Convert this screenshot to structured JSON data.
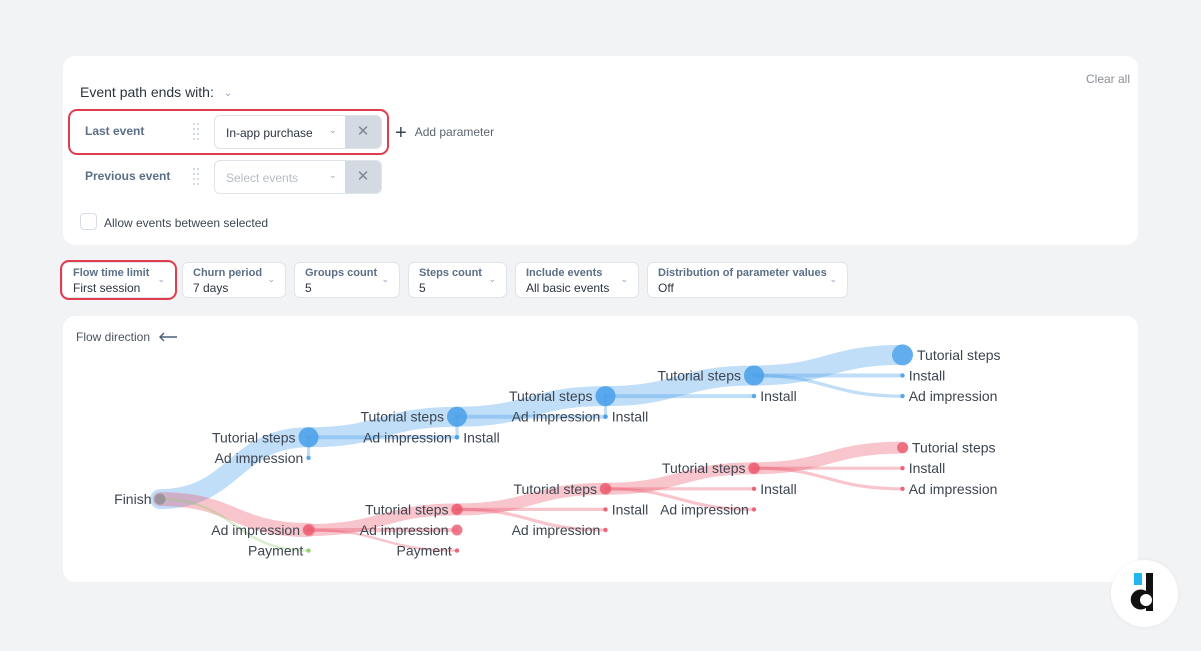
{
  "filters": {
    "title": "Event path ends with:",
    "clear_all": "Clear all",
    "rows": [
      {
        "label": "Last event",
        "value": "In-app purchase",
        "placeholder": ""
      },
      {
        "label": "Previous event",
        "value": "",
        "placeholder": "Select events"
      }
    ],
    "add_parameter": "Add parameter",
    "allow_between": {
      "label": "Allow events between selected",
      "checked": false
    },
    "highlight_color": "#e23d4f"
  },
  "settings": [
    {
      "label": "Flow time limit",
      "value": "First session",
      "highlighted": true
    },
    {
      "label": "Churn period",
      "value": "7 days"
    },
    {
      "label": "Groups count",
      "value": "5"
    },
    {
      "label": "Steps count",
      "value": "5"
    },
    {
      "label": "Include events",
      "value": "All basic events"
    },
    {
      "label": "Distribution of parameter values",
      "value": "Off"
    }
  ],
  "flow": {
    "direction_label": "Flow direction",
    "colors": {
      "blue": "#4aa0ea",
      "red": "#ea5a6e",
      "green": "#8fce6a",
      "finish": "#8d8d94"
    },
    "nodes": [
      {
        "id": "finish",
        "label": "Finish",
        "step": 0,
        "row": 3.5,
        "color": "finish",
        "size": "m"
      },
      {
        "id": "b1",
        "label": "Tutorial steps",
        "step": 1,
        "row": 0.5,
        "color": "blue",
        "size": "l"
      },
      {
        "id": "b1i",
        "label": "Install",
        "step": 2,
        "row": 0.5,
        "color": "blue",
        "size": "s",
        "labelSide": "right"
      },
      {
        "id": "b1a",
        "label": "Ad impression",
        "step": 1,
        "row": 1.5,
        "color": "blue",
        "size": "s"
      },
      {
        "id": "b2",
        "label": "Tutorial steps",
        "step": 2,
        "row": -0.5,
        "color": "blue",
        "size": "l"
      },
      {
        "id": "b2a",
        "label": "Ad impression",
        "step": 2,
        "row": 0.5,
        "color": "blue",
        "size": "s"
      },
      {
        "id": "b2i",
        "label": "Install",
        "step": 3,
        "row": -0.5,
        "color": "blue",
        "size": "s",
        "labelSide": "right"
      },
      {
        "id": "b3",
        "label": "Tutorial steps",
        "step": 3,
        "row": -1.5,
        "color": "blue",
        "size": "l"
      },
      {
        "id": "b3a",
        "label": "Ad impression",
        "step": 3,
        "row": -0.5,
        "color": "blue",
        "size": "s"
      },
      {
        "id": "b3i",
        "label": "Install",
        "step": 4,
        "row": -1.5,
        "color": "blue",
        "size": "s",
        "labelSide": "right"
      },
      {
        "id": "b4",
        "label": "Tutorial steps",
        "step": 4,
        "row": -2.5,
        "color": "blue",
        "size": "l"
      },
      {
        "id": "b5",
        "label": "Tutorial steps",
        "step": 5,
        "row": -3.5,
        "color": "blue",
        "size": "xl",
        "labelSide": "right"
      },
      {
        "id": "b5i",
        "label": "Install",
        "step": 5,
        "row": -2.5,
        "color": "blue",
        "size": "s",
        "labelSide": "right"
      },
      {
        "id": "b5a",
        "label": "Ad impression",
        "step": 5,
        "row": -1.5,
        "color": "blue",
        "size": "s",
        "labelSide": "right"
      },
      {
        "id": "r1",
        "label": "Ad impression",
        "step": 1,
        "row": 5,
        "color": "red",
        "size": "m"
      },
      {
        "id": "p1",
        "label": "Payment",
        "step": 1,
        "row": 6,
        "color": "green",
        "size": "s"
      },
      {
        "id": "r2",
        "label": "Tutorial steps",
        "step": 2,
        "row": 4,
        "color": "red",
        "size": "m"
      },
      {
        "id": "r2a",
        "label": "Ad impression",
        "step": 2,
        "row": 5,
        "color": "red",
        "size": "m"
      },
      {
        "id": "r2p",
        "label": "Payment",
        "step": 2,
        "row": 6,
        "color": "red",
        "size": "s"
      },
      {
        "id": "r2i",
        "label": "Install",
        "step": 3,
        "row": 4,
        "color": "red",
        "size": "s",
        "labelSide": "right"
      },
      {
        "id": "r2ad",
        "label": "Ad impression",
        "step": 3,
        "row": 5,
        "color": "red",
        "size": "s"
      },
      {
        "id": "r3",
        "label": "Tutorial steps",
        "step": 3,
        "row": 3,
        "color": "red",
        "size": "m"
      },
      {
        "id": "r3a",
        "label": "Ad impression",
        "step": 4,
        "row": 4,
        "color": "red",
        "size": "s"
      },
      {
        "id": "r3i",
        "label": "Install",
        "step": 4,
        "row": 3,
        "color": "red",
        "size": "s",
        "labelSide": "right"
      },
      {
        "id": "r4",
        "label": "Tutorial steps",
        "step": 4,
        "row": 2,
        "color": "red",
        "size": "m"
      },
      {
        "id": "r5",
        "label": "Tutorial steps",
        "step": 5,
        "row": 1,
        "color": "red",
        "size": "m",
        "labelSide": "right"
      },
      {
        "id": "r5i",
        "label": "Install",
        "step": 5,
        "row": 2,
        "color": "red",
        "size": "s",
        "labelSide": "right"
      },
      {
        "id": "r5a",
        "label": "Ad impression",
        "step": 5,
        "row": 3,
        "color": "red",
        "size": "s",
        "labelSide": "right"
      }
    ],
    "links": [
      {
        "from": "finish",
        "to": "b1",
        "weight": 5,
        "color": "blue"
      },
      {
        "from": "finish",
        "to": "r1",
        "weight": 3.5,
        "color": "red"
      },
      {
        "from": "finish",
        "to": "p1",
        "weight": 0.6,
        "color": "green"
      },
      {
        "from": "b1",
        "to": "b2",
        "weight": 5,
        "color": "blue"
      },
      {
        "from": "b1",
        "to": "b1i",
        "weight": 1,
        "color": "blue"
      },
      {
        "from": "b1",
        "to": "b1a",
        "weight": 0.8,
        "color": "blue"
      },
      {
        "from": "b2",
        "to": "b3",
        "weight": 5,
        "color": "blue"
      },
      {
        "from": "b2",
        "to": "b2i",
        "weight": 1,
        "color": "blue"
      },
      {
        "from": "b2",
        "to": "b2a",
        "weight": 0.8,
        "color": "blue"
      },
      {
        "from": "b3",
        "to": "b4",
        "weight": 5,
        "color": "blue"
      },
      {
        "from": "b3",
        "to": "b3i",
        "weight": 1,
        "color": "blue"
      },
      {
        "from": "b3",
        "to": "b3a",
        "weight": 0.8,
        "color": "blue"
      },
      {
        "from": "b4",
        "to": "b5",
        "weight": 5,
        "color": "blue"
      },
      {
        "from": "b4",
        "to": "b5i",
        "weight": 1,
        "color": "blue"
      },
      {
        "from": "b4",
        "to": "b5a",
        "weight": 0.8,
        "color": "blue"
      },
      {
        "from": "r1",
        "to": "r2",
        "weight": 3,
        "color": "red"
      },
      {
        "from": "r1",
        "to": "r2a",
        "weight": 1,
        "color": "red"
      },
      {
        "from": "r1",
        "to": "r2p",
        "weight": 0.6,
        "color": "red"
      },
      {
        "from": "r2",
        "to": "r3",
        "weight": 3,
        "color": "red"
      },
      {
        "from": "r2",
        "to": "r2i",
        "weight": 0.8,
        "color": "red"
      },
      {
        "from": "r2",
        "to": "r2ad",
        "weight": 0.8,
        "color": "red"
      },
      {
        "from": "r3",
        "to": "r4",
        "weight": 3,
        "color": "red"
      },
      {
        "from": "r3",
        "to": "r3i",
        "weight": 0.8,
        "color": "red"
      },
      {
        "from": "r3",
        "to": "r3a",
        "weight": 0.8,
        "color": "red"
      },
      {
        "from": "r4",
        "to": "r5",
        "weight": 3,
        "color": "red"
      },
      {
        "from": "r4",
        "to": "r5i",
        "weight": 0.8,
        "color": "red"
      },
      {
        "from": "r4",
        "to": "r5a",
        "weight": 0.8,
        "color": "red"
      }
    ]
  }
}
